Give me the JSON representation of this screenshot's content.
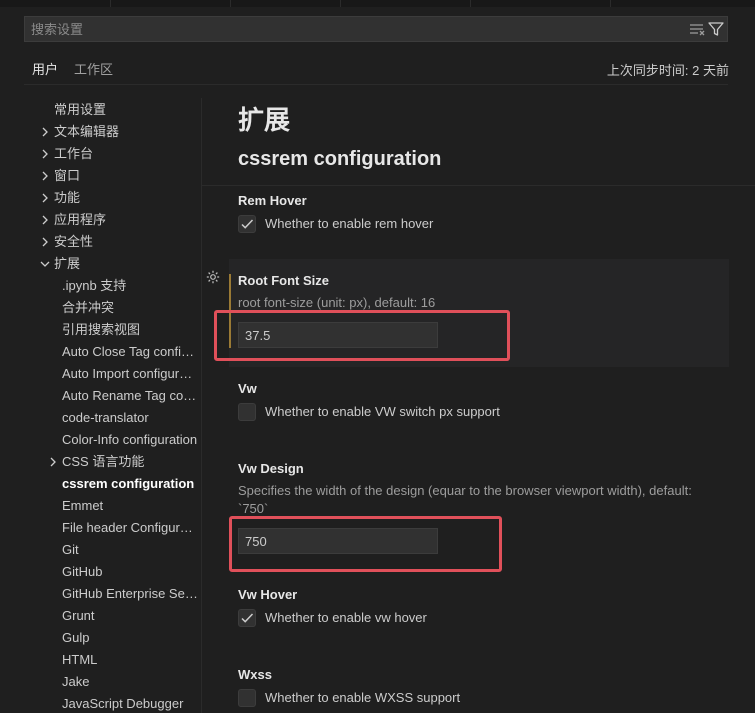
{
  "search": {
    "placeholder": "搜索设置"
  },
  "scopes": {
    "user": "用户",
    "workspace": "工作区",
    "last_sync": "上次同步时间: 2 天前"
  },
  "toc": {
    "items": [
      {
        "label": "常用设置"
      },
      {
        "label": "文本编辑器",
        "chevron": "right"
      },
      {
        "label": "工作台",
        "chevron": "right"
      },
      {
        "label": "窗口",
        "chevron": "right"
      },
      {
        "label": "功能",
        "chevron": "right"
      },
      {
        "label": "应用程序",
        "chevron": "right"
      },
      {
        "label": "安全性",
        "chevron": "right"
      },
      {
        "label": "扩展",
        "chevron": "down"
      },
      {
        "label": ".ipynb 支持"
      },
      {
        "label": "合并冲突"
      },
      {
        "label": "引用搜索视图"
      },
      {
        "label": "Auto Close Tag configuration"
      },
      {
        "label": "Auto Import configuration"
      },
      {
        "label": "Auto Rename Tag configuration"
      },
      {
        "label": "code-translator"
      },
      {
        "label": "Color-Info configuration"
      },
      {
        "label": "CSS 语言功能",
        "chevron": "right"
      },
      {
        "label": "cssrem configuration",
        "active": true
      },
      {
        "label": "Emmet"
      },
      {
        "label": "File header Configuration"
      },
      {
        "label": "Git"
      },
      {
        "label": "GitHub"
      },
      {
        "label": "GitHub Enterprise Server Authentication"
      },
      {
        "label": "Grunt"
      },
      {
        "label": "Gulp"
      },
      {
        "label": "HTML"
      },
      {
        "label": "Jake"
      },
      {
        "label": "JavaScript Debugger"
      }
    ]
  },
  "content": {
    "section_title": "扩展",
    "group_title": "cssrem configuration",
    "settings": {
      "rem_hover": {
        "title": "Rem Hover",
        "label": "Whether to enable rem hover",
        "checked": true
      },
      "root_font_size": {
        "title": "Root Font Size",
        "desc": "root font-size (unit: px), default: 16",
        "value": "37.5"
      },
      "vw": {
        "title": "Vw",
        "label": "Whether to enable VW switch px support",
        "checked": false
      },
      "vw_design": {
        "title": "Vw Design",
        "desc_line1": "Specifies the width of the design (equar to the browser viewport width), default:",
        "desc_line2": "`750`",
        "value": "750"
      },
      "vw_hover": {
        "title": "Vw Hover",
        "label": "Whether to enable vw hover",
        "checked": true
      },
      "wxss": {
        "title": "Wxss",
        "label": "Whether to enable WXSS support",
        "checked": false
      }
    }
  },
  "icons": {
    "search_bar": [
      "clear-filter-icon",
      "filter-icon"
    ],
    "focused_row": "gear-icon",
    "checkbox": "check-icon"
  },
  "colors": {
    "background": "#1f1f1f",
    "focus_indicator": "#9a7a35",
    "annotation_highlight": "#e0505a"
  }
}
